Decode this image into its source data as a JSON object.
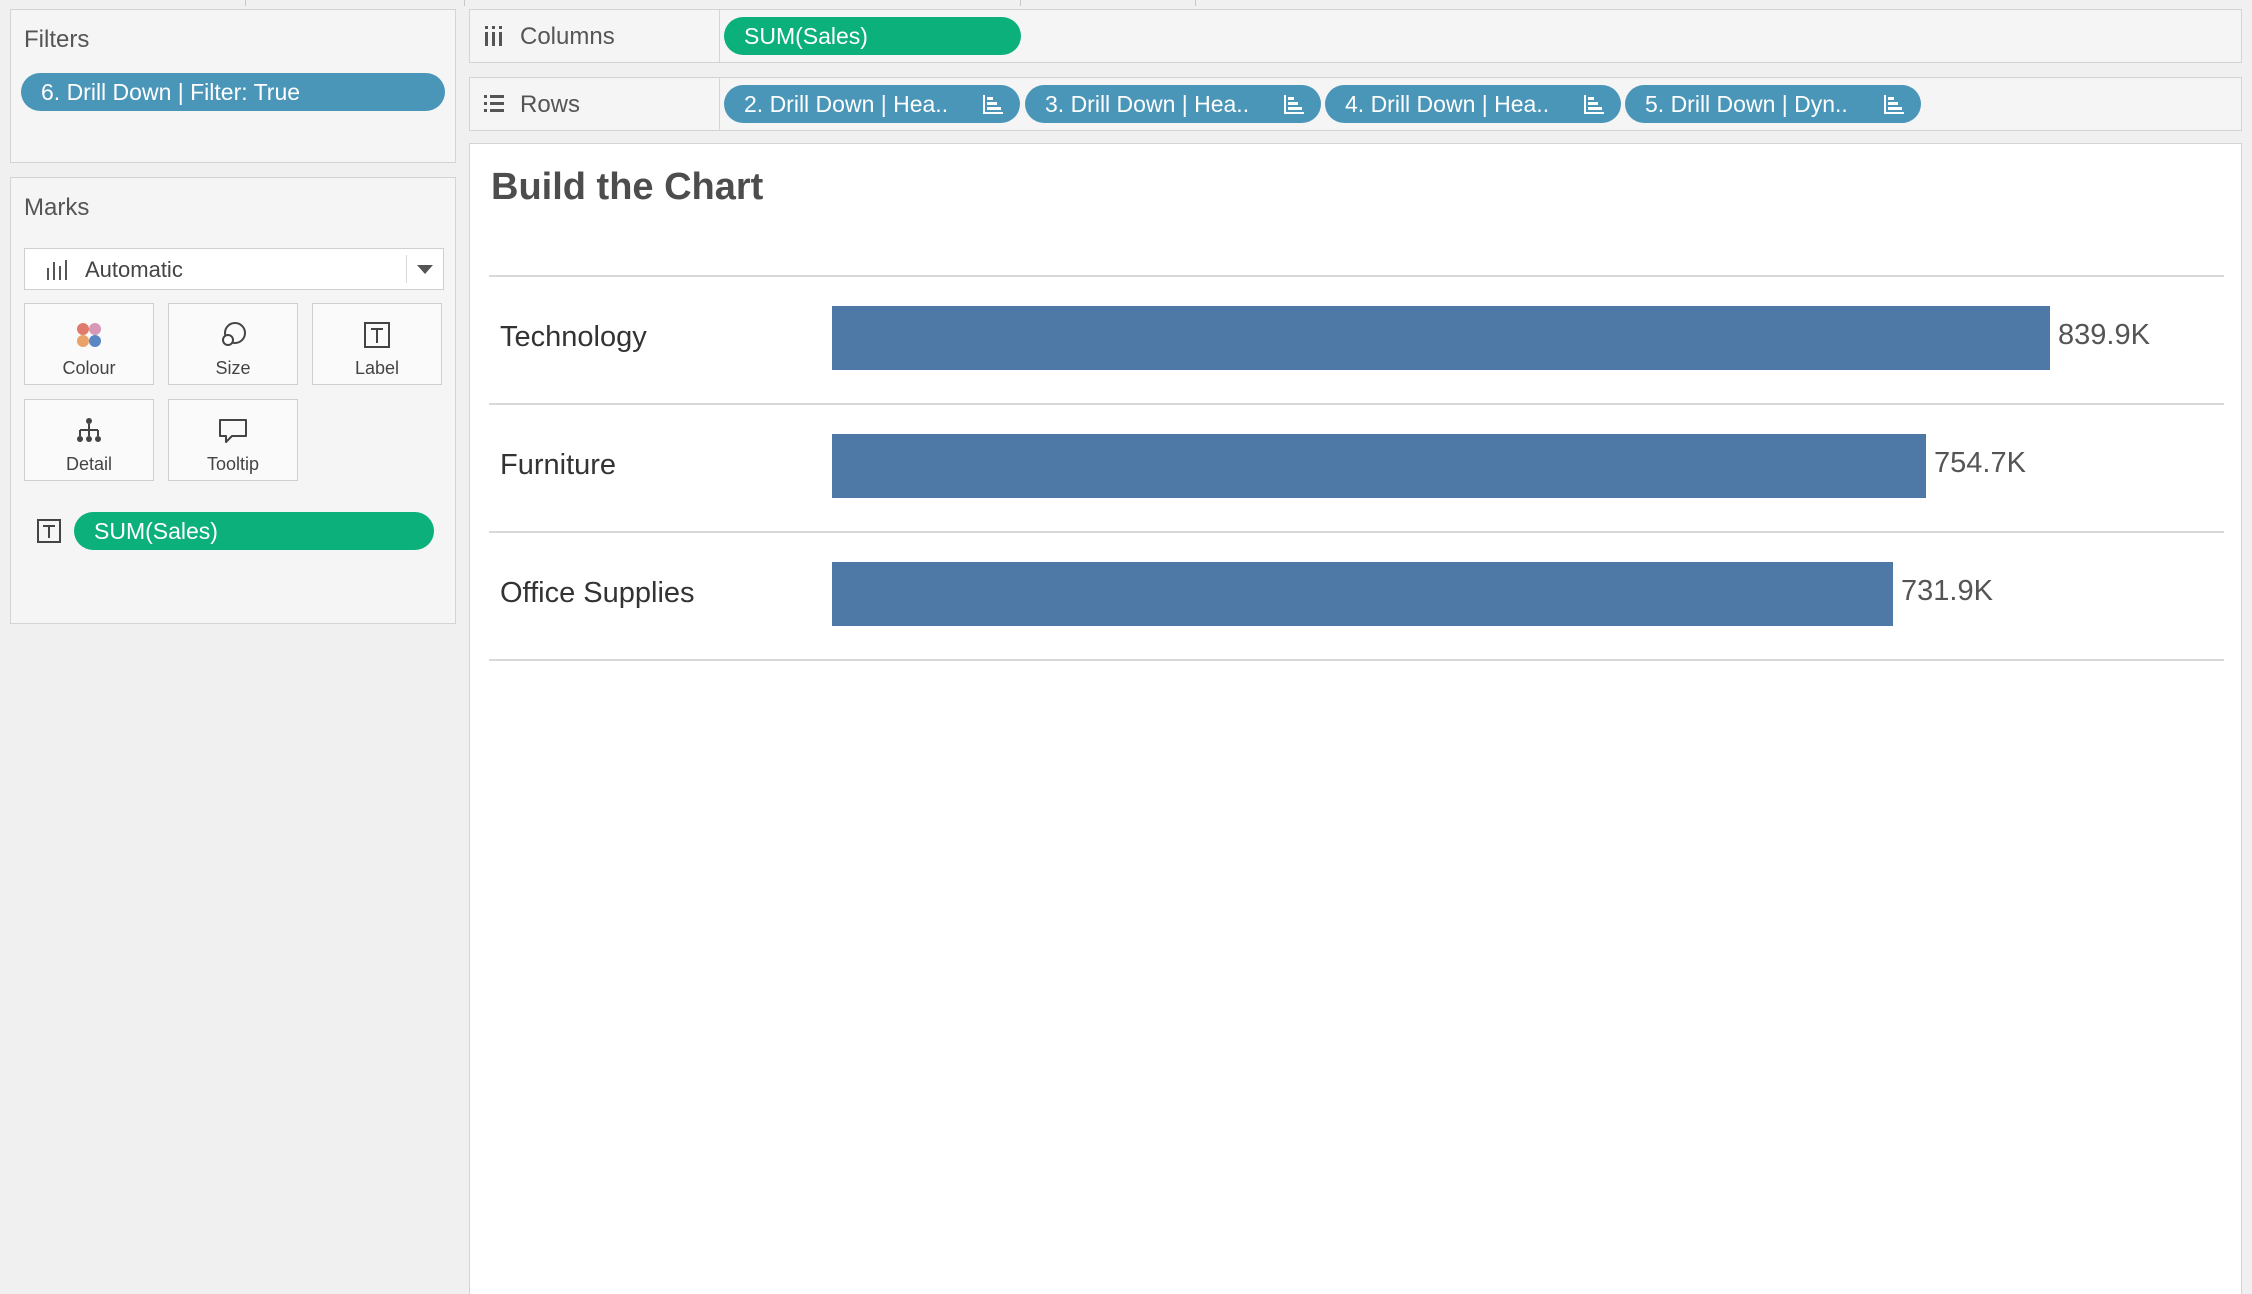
{
  "filters": {
    "title": "Filters",
    "pill": "6. Drill Down | Filter: True"
  },
  "marks": {
    "title": "Marks",
    "type_selected": "Automatic",
    "buttons": [
      "Colour",
      "Size",
      "Label",
      "Detail",
      "Tooltip"
    ],
    "label_pill": "SUM(Sales)"
  },
  "columns": {
    "label": "Columns",
    "pills": [
      "SUM(Sales)"
    ]
  },
  "rows": {
    "label": "Rows",
    "pills": [
      "2. Drill Down | Hea..",
      "3. Drill Down | Hea..",
      "4. Drill Down | Hea..",
      "5. Drill Down | Dyn.."
    ]
  },
  "colors": {
    "bar": "#4e79a7",
    "pill_blue": "#4a96b9",
    "pill_green": "#0cb07b"
  },
  "chart_data": {
    "type": "bar",
    "orientation": "horizontal",
    "title": "Build the Chart",
    "categories": [
      "Technology",
      "Furniture",
      "Office Supplies"
    ],
    "values": [
      839.9,
      754.7,
      731.9
    ],
    "value_labels": [
      "839.9K",
      "754.7K",
      "731.9K"
    ],
    "unit": "K",
    "xlim": [
      0,
      839.9
    ],
    "grid": false
  }
}
